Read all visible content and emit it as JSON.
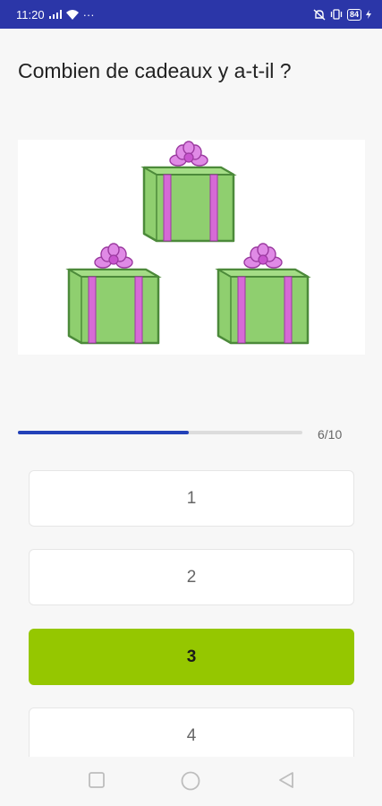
{
  "status_bar": {
    "time": "11:20",
    "overflow": "···",
    "battery": "84",
    "icons": [
      "signal-icon",
      "wifi-icon",
      "mute-icon",
      "vibrate-icon",
      "battery-icon",
      "charging-icon"
    ]
  },
  "question": "Combien de cadeaux y a-t-il ?",
  "illustration": {
    "subject": "gift boxes",
    "gift_count": 3,
    "colors": {
      "box": "#8fcf6f",
      "box_dark": "#4c8a3a",
      "ribbon": "#d66ad6",
      "bow": "#e08ae6"
    }
  },
  "progress": {
    "label": "6/10",
    "fraction": 0.6
  },
  "answers": [
    {
      "label": "1",
      "selected": false
    },
    {
      "label": "2",
      "selected": false
    },
    {
      "label": "3",
      "selected": true
    },
    {
      "label": "4",
      "selected": false
    }
  ],
  "nav_bar": {
    "buttons": [
      "recents-icon",
      "home-icon",
      "back-icon"
    ]
  },
  "colors": {
    "status_bar": "#2b36a8",
    "progress": "#2341b8",
    "selected_answer": "#95c700"
  }
}
